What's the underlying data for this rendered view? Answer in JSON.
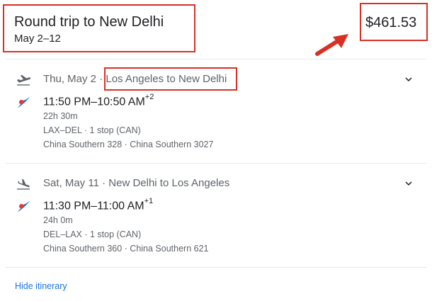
{
  "trip": {
    "title": "Round trip to New Delhi",
    "dates": "May 2–12",
    "price": "$461.53"
  },
  "legs": [
    {
      "date": "Thu, May 2",
      "separator": " · ",
      "route": "Los Angeles to New Delhi",
      "times": "11:50 PM–10:50 AM",
      "day_offset": "+2",
      "duration": "22h 30m",
      "stops": "LAX–DEL · 1 stop (CAN)",
      "flights": "China Southern 328 · China Southern 3027"
    },
    {
      "date": "Sat, May 11",
      "separator": " · ",
      "route": "New Delhi to Los Angeles",
      "times": "11:30 PM–11:00 AM",
      "day_offset": "+1",
      "duration": "24h 0m",
      "stops": "DEL–LAX · 1 stop (CAN)",
      "flights": "China Southern 360 · China Southern 621"
    }
  ],
  "footer": {
    "hide_itinerary": "Hide itinerary"
  },
  "icons": {
    "departure": "flight-takeoff-icon",
    "landing": "flight-land-icon",
    "airline": "china-southern-logo-icon",
    "expand": "chevron-down-icon"
  },
  "colors": {
    "highlight_red": "#d93025",
    "link_blue": "#1a73e8",
    "airline_blue": "#1a73c8",
    "airline_red": "#e03a3e"
  }
}
